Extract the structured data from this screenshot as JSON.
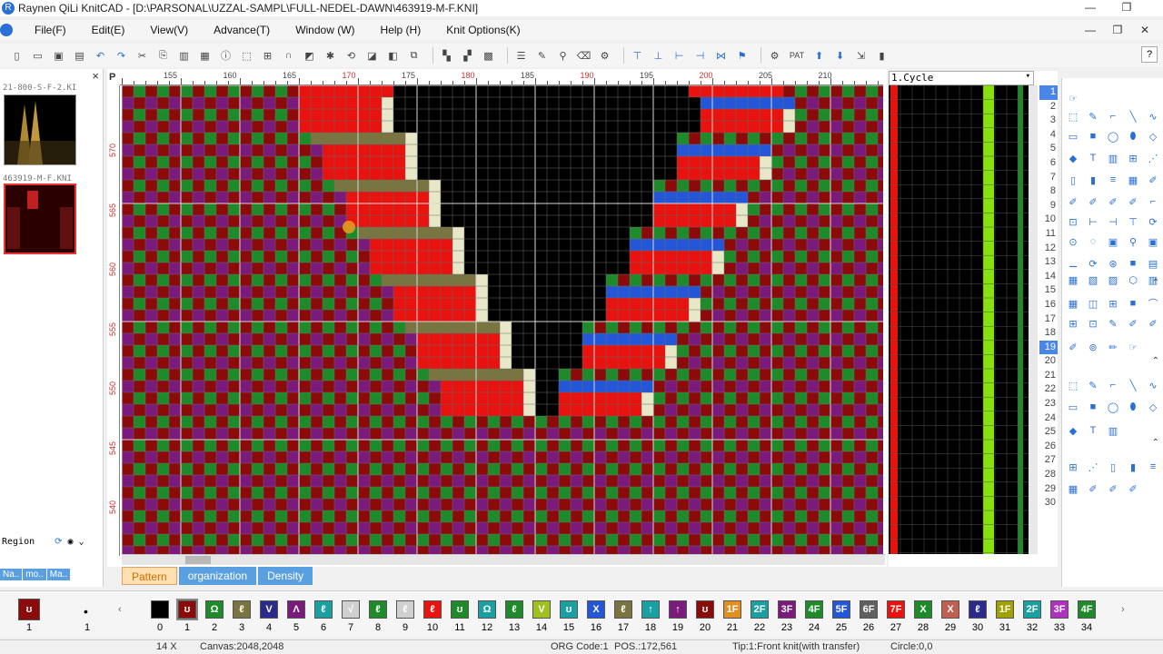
{
  "window": {
    "title": "Raynen QiLi KnitCAD - [D:\\PARSONAL\\UZZAL-SAMPL\\FULL-NEDEL-DAWN\\463919-M-F.KNI]",
    "minimize": "—",
    "restore": "❐",
    "close": "✕",
    "child_minimize": "—",
    "child_restore": "❐",
    "child_close": "✕"
  },
  "menu": [
    "File(F)",
    "Edit(E)",
    "View(V)",
    "Advance(T)",
    "Window (W)",
    "Help (H)",
    "Knit Options(K)"
  ],
  "help_button": "?",
  "toolbar_icons": [
    "new-file",
    "open",
    "save",
    "save-all",
    "undo",
    "redo",
    "cut",
    "copy",
    "paste",
    "grid",
    "info",
    "select-area",
    "zoom-select",
    "curve-tool",
    "color-swap",
    "settings",
    "rotate",
    "mirror",
    "flip",
    "copy-range",
    "sep",
    "color-fill",
    "color-mix",
    "color-palette",
    "sep",
    "text",
    "pencil",
    "brush",
    "eraser",
    "spray",
    "sep",
    "cycle-a",
    "cycle-b",
    "cycle-c",
    "cycle-d",
    "cycle-e",
    "cycle-f",
    "sep",
    "gear",
    "pat",
    "up-arrow",
    "down-arrow",
    "export",
    "barcode"
  ],
  "toolbar_pat": "PAT",
  "left": {
    "close": "×",
    "thumb1_label": "21-800-S-F-2.KI",
    "thumb2_label": "463919-M-F.KNI",
    "region_label": "Region",
    "tabs": [
      "Na..",
      "mo..",
      "Ma.."
    ]
  },
  "editor": {
    "p_label": "P",
    "ruler_top": [
      "155",
      "160",
      "165",
      "170",
      "175",
      "180",
      "185",
      "190",
      "195",
      "200",
      "205",
      "210"
    ],
    "ruler_left": [
      "570",
      "565",
      "560",
      "555",
      "550",
      "545",
      "540"
    ],
    "colors": {
      "maroon": "#8b0a0a",
      "green": "#1f8a2a",
      "purple": "#7a1a7a",
      "red": "#e8120e",
      "black": "#000000",
      "olive": "#7a7440",
      "blue": "#2456d8",
      "cream": "#e8e8c8"
    }
  },
  "cycle": {
    "header": "1.Cycle",
    "rows": [
      "1",
      "2",
      "3",
      "4",
      "5",
      "6",
      "7",
      "8",
      "9",
      "10",
      "11",
      "12",
      "13",
      "14",
      "15",
      "16",
      "17",
      "18",
      "19",
      "20",
      "21",
      "22",
      "23",
      "24",
      "25",
      "26",
      "27",
      "28",
      "29",
      "30"
    ],
    "selected_rows": [
      "1",
      "19"
    ]
  },
  "right_tools": {
    "sections": 3,
    "collapse_glyph": "⌃"
  },
  "bottom_tabs": [
    "Pattern",
    "organization",
    "Density"
  ],
  "palette": {
    "current": "ʊ",
    "current_num": "1",
    "dot_num": "1",
    "swatches": [
      {
        "n": "0",
        "sym": "",
        "c": "#000000"
      },
      {
        "n": "1",
        "sym": "ʊ",
        "c": "#8b0a0a"
      },
      {
        "n": "2",
        "sym": "Ω",
        "c": "#1f8a2a"
      },
      {
        "n": "3",
        "sym": "ℓ",
        "c": "#7a7440"
      },
      {
        "n": "4",
        "sym": "V",
        "c": "#2a2a8a"
      },
      {
        "n": "5",
        "sym": "Λ",
        "c": "#7a1a7a"
      },
      {
        "n": "6",
        "sym": "ℓ",
        "c": "#1aa0a0"
      },
      {
        "n": "7",
        "sym": "√",
        "c": "#d0d0d0"
      },
      {
        "n": "8",
        "sym": "ℓ",
        "c": "#1f8a2a"
      },
      {
        "n": "9",
        "sym": "ℓ",
        "c": "#d0d0d0"
      },
      {
        "n": "10",
        "sym": "ℓ",
        "c": "#e8120e"
      },
      {
        "n": "11",
        "sym": "ʊ",
        "c": "#1f8a2a"
      },
      {
        "n": "12",
        "sym": "Ω",
        "c": "#1aa0a0"
      },
      {
        "n": "13",
        "sym": "ℓ",
        "c": "#1f8a2a"
      },
      {
        "n": "14",
        "sym": "V",
        "c": "#a0c020"
      },
      {
        "n": "15",
        "sym": "ʊ",
        "c": "#1aa0a0"
      },
      {
        "n": "16",
        "sym": "X",
        "c": "#2456d8"
      },
      {
        "n": "17",
        "sym": "ℓ",
        "c": "#7a7440"
      },
      {
        "n": "18",
        "sym": "↑",
        "c": "#1aa0a0"
      },
      {
        "n": "19",
        "sym": "↑",
        "c": "#7a1a7a"
      },
      {
        "n": "20",
        "sym": "ʊ",
        "c": "#8b0a0a"
      },
      {
        "n": "21",
        "sym": "1F",
        "c": "#e09020"
      },
      {
        "n": "22",
        "sym": "2F",
        "c": "#1aa0a0"
      },
      {
        "n": "23",
        "sym": "3F",
        "c": "#7a1a7a"
      },
      {
        "n": "24",
        "sym": "4F",
        "c": "#1f8a2a"
      },
      {
        "n": "25",
        "sym": "5F",
        "c": "#2456d8"
      },
      {
        "n": "26",
        "sym": "6F",
        "c": "#606060"
      },
      {
        "n": "27",
        "sym": "7F",
        "c": "#e8120e"
      },
      {
        "n": "28",
        "sym": "X",
        "c": "#1f8a2a"
      },
      {
        "n": "29",
        "sym": "X",
        "c": "#c06050"
      },
      {
        "n": "30",
        "sym": "ℓ",
        "c": "#2a2a8a"
      },
      {
        "n": "31",
        "sym": "1F",
        "c": "#a0a000"
      },
      {
        "n": "32",
        "sym": "2F",
        "c": "#1aa0a0"
      },
      {
        "n": "33",
        "sym": "3F",
        "c": "#b030c0"
      },
      {
        "n": "34",
        "sym": "4F",
        "c": "#1f8a2a"
      }
    ]
  },
  "status": {
    "zoom": "14 X",
    "canvas": "Canvas:2048,2048",
    "org_code": "ORG Code:1",
    "pos": "POS.:172,561",
    "tip": "Tip:1:Front knit(with transfer)",
    "circle": "Circle:0,0"
  }
}
